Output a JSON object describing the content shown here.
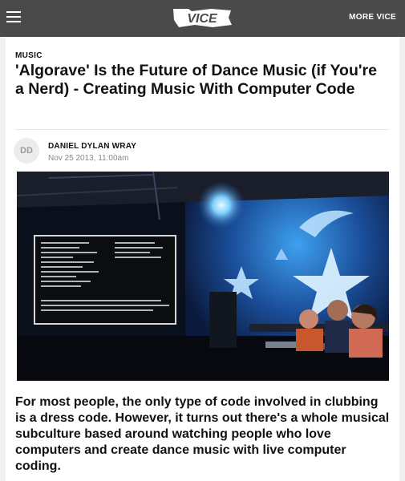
{
  "header": {
    "logo_text": "VICE",
    "more_label": "MORE VICE"
  },
  "article": {
    "category": "MUSIC",
    "title": "'Algorave' Is the Future of Dance Music (if You're a Nerd) - Creating Music With Computer Code",
    "author_initials": "DD",
    "author": "DANIEL DYLAN WRAY",
    "date": "Nov 25 2013, 11:00am",
    "lede": "For most people, the only type of code involved in clubbing is a dress code. However, it turns out there's a whole musical subculture based around watching people who love computers and create dance music with live computer coding."
  },
  "colors": {
    "topbar": "#4a4a4a",
    "page_bg": "#f0f0f0",
    "card_bg": "#ffffff",
    "text": "#111111",
    "muted": "#888888"
  },
  "icons": [
    "hamburger-menu-icon"
  ]
}
